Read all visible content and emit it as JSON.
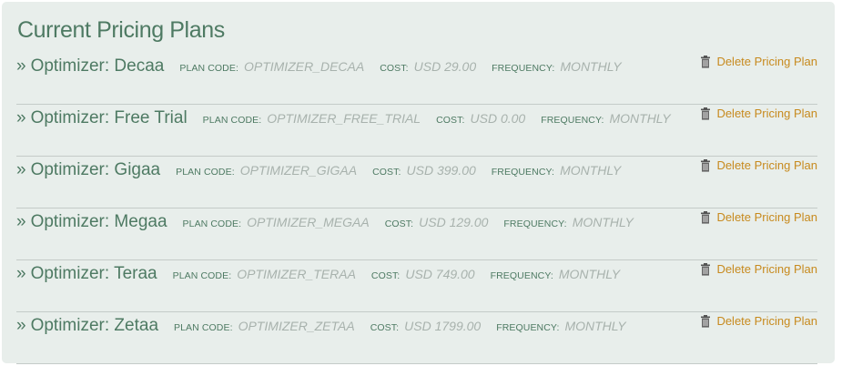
{
  "panel": {
    "title": "Current Pricing Plans"
  },
  "labels": {
    "bullet": "»",
    "plan_code": "PLAN CODE:",
    "cost": "COST:",
    "frequency": "FREQUENCY:",
    "delete": "Delete Pricing Plan"
  },
  "icons": {
    "delete": "trash-icon"
  },
  "colors": {
    "panel_bg": "#e8eeeb",
    "title": "#4e7a63",
    "value": "#a8b2ad",
    "link": "#c78a1e"
  },
  "plans": [
    {
      "name": "Optimizer: Decaa",
      "code": "OPTIMIZER_DECAA",
      "cost": "USD 29.00",
      "frequency": "MONTHLY"
    },
    {
      "name": "Optimizer: Free Trial",
      "code": "OPTIMIZER_FREE_TRIAL",
      "cost": "USD 0.00",
      "frequency": "MONTHLY"
    },
    {
      "name": "Optimizer: Gigaa",
      "code": "OPTIMIZER_GIGAA",
      "cost": "USD 399.00",
      "frequency": "MONTHLY"
    },
    {
      "name": "Optimizer: Megaa",
      "code": "OPTIMIZER_MEGAA",
      "cost": "USD 129.00",
      "frequency": "MONTHLY"
    },
    {
      "name": "Optimizer: Teraa",
      "code": "OPTIMIZER_TERAA",
      "cost": "USD 749.00",
      "frequency": "MONTHLY"
    },
    {
      "name": "Optimizer: Zetaa",
      "code": "OPTIMIZER_ZETAA",
      "cost": "USD 1799.00",
      "frequency": "MONTHLY"
    }
  ]
}
